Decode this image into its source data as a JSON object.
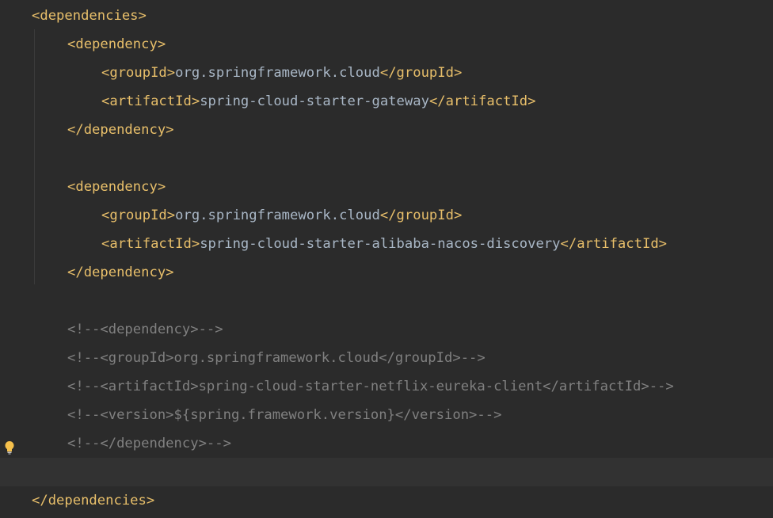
{
  "editor": {
    "lines": [
      {
        "parts": [
          {
            "t": "tag",
            "s": "<dependencies>"
          }
        ]
      },
      {
        "parts": [
          {
            "t": "tag",
            "s": "<dependency>"
          }
        ]
      },
      {
        "parts": [
          {
            "t": "tag",
            "s": "<groupId>"
          },
          {
            "t": "txt",
            "s": "org.springframework.cloud"
          },
          {
            "t": "tag",
            "s": "</groupId>"
          }
        ]
      },
      {
        "parts": [
          {
            "t": "tag",
            "s": "<artifactId>"
          },
          {
            "t": "txt",
            "s": "spring-cloud-starter-gateway"
          },
          {
            "t": "tag",
            "s": "</artifactId>"
          }
        ]
      },
      {
        "parts": [
          {
            "t": "tag",
            "s": "</dependency>"
          }
        ]
      },
      {
        "parts": []
      },
      {
        "parts": [
          {
            "t": "tag",
            "s": "<dependency>"
          }
        ]
      },
      {
        "parts": [
          {
            "t": "tag",
            "s": "<groupId>"
          },
          {
            "t": "txt",
            "s": "org.springframework.cloud"
          },
          {
            "t": "tag",
            "s": "</groupId>"
          }
        ]
      },
      {
        "parts": [
          {
            "t": "tag",
            "s": "<artifactId>"
          },
          {
            "t": "txt",
            "s": "spring-cloud-starter-alibaba-nacos-discovery"
          },
          {
            "t": "tag",
            "s": "</artifactId>"
          }
        ]
      },
      {
        "parts": [
          {
            "t": "tag",
            "s": "</dependency>"
          }
        ]
      },
      {
        "parts": []
      },
      {
        "parts": [
          {
            "t": "cmt",
            "s": "<!--<dependency>-->"
          }
        ]
      },
      {
        "parts": [
          {
            "t": "cmt",
            "s": "<!--<groupId>org.springframework.cloud</groupId>-->"
          }
        ]
      },
      {
        "parts": [
          {
            "t": "cmt",
            "s": "<!--<artifactId>spring-cloud-starter-netflix-eureka-client</artifactId>-->"
          }
        ]
      },
      {
        "parts": [
          {
            "t": "cmt",
            "s": "<!--<version>${spring.framework.version}</version>-->"
          }
        ]
      },
      {
        "parts": [
          {
            "t": "cmt",
            "s": "<!--</dependency>-->"
          }
        ]
      },
      {
        "parts": []
      },
      {
        "parts": [
          {
            "t": "tag",
            "s": "</dependencies>"
          }
        ]
      }
    ],
    "intention_icon": "lightbulb-icon",
    "colors": {
      "background": "#2b2b2b",
      "current_line": "#323232",
      "tag": "#e8bf6a",
      "text": "#a9b7c6",
      "comment": "#808080"
    }
  }
}
